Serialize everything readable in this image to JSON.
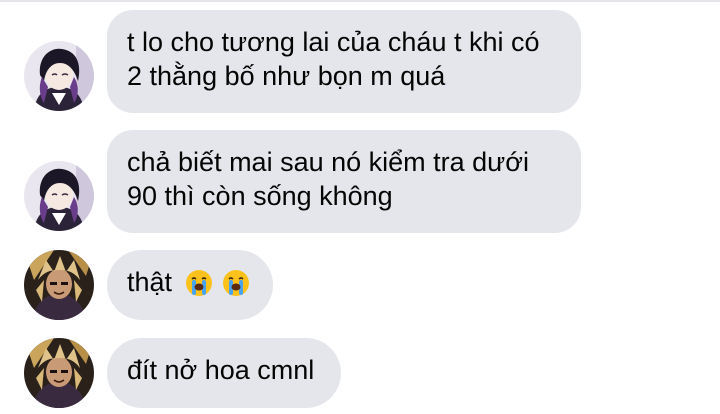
{
  "messages": [
    {
      "sender": "user-a",
      "lines": [
        "t lo cho tương lai của cháu t khi có",
        "2 thằng bố như bọn m quá"
      ]
    },
    {
      "sender": "user-a",
      "lines": [
        "chả biết mai sau nó kiểm tra dưới",
        "90 thì còn sống không"
      ]
    },
    {
      "sender": "user-b",
      "lines": [
        "thật"
      ],
      "emojis": [
        "loudly-crying-face-icon",
        "loudly-crying-face-icon"
      ]
    },
    {
      "sender": "user-b",
      "lines": [
        "đít nở hoa cmnl"
      ]
    }
  ],
  "colors": {
    "bubble": "#e4e6eb",
    "text": "#050505",
    "background": "#ffffff"
  }
}
